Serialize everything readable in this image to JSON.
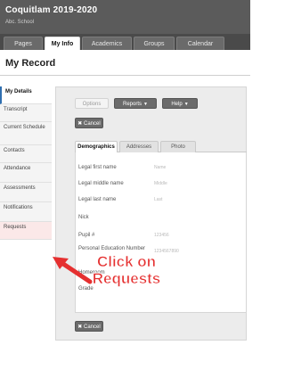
{
  "app": {
    "title": "Coquitlam 2019-2020",
    "subtitle": "Abc. School"
  },
  "tabs": [
    "Pages",
    "My Info",
    "Academics",
    "Groups",
    "Calendar"
  ],
  "active_tab": "My Info",
  "section_title": "My Record",
  "sidebar": {
    "items": [
      "My Details",
      "Transcript",
      "Current Schedule",
      "Contacts",
      "Attendance",
      "Assessments",
      "Notifications",
      "Requests"
    ],
    "active": "My Details",
    "highlighted": "Requests"
  },
  "toolbar": {
    "options_label": "Options",
    "reports_label": "Reports",
    "help_label": "Help"
  },
  "cancel_label": "Cancel",
  "subtabs": [
    "Demographics",
    "Addresses",
    "Photo"
  ],
  "form": {
    "rows": [
      {
        "label": "Legal first name",
        "value": "Name"
      },
      {
        "label": "Legal middle name",
        "value": "Middle"
      },
      {
        "label": "Legal last name",
        "value": "Last"
      },
      {
        "label": "Nick",
        "value": ""
      },
      {
        "label": "Pupil #",
        "value": "123456"
      },
      {
        "label": "Personal Education Number",
        "value": "1234567890"
      },
      {
        "label": "Homeroom",
        "value": ""
      },
      {
        "label": "Grade",
        "value": ""
      }
    ]
  },
  "callout": {
    "line1": "Click on",
    "line2": "Requests"
  },
  "colors": {
    "header": "#5b5b5b",
    "callout": "#e53030",
    "accent": "#2f6fb0"
  }
}
